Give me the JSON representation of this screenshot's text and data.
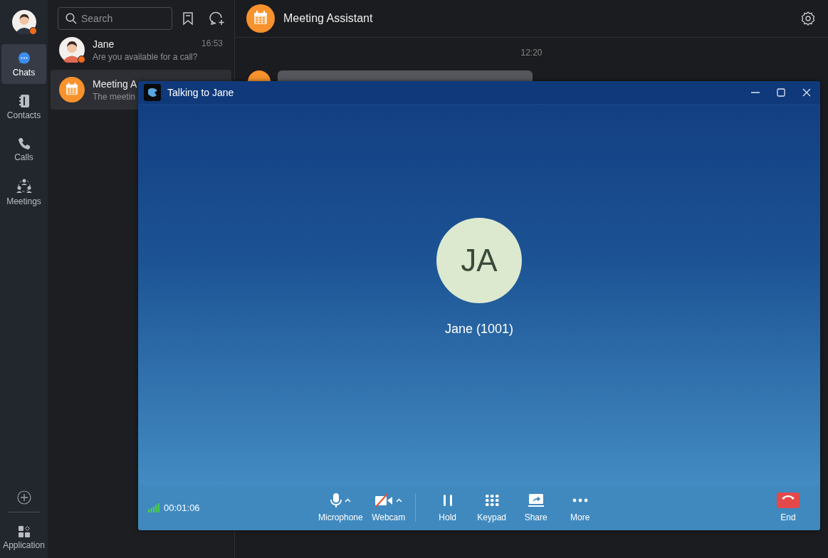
{
  "profile": {
    "status_dot": true
  },
  "nav": [
    {
      "label": "Chats",
      "kind": "chat",
      "selected": true
    },
    {
      "label": "Contacts",
      "kind": "contacts",
      "selected": false
    },
    {
      "label": "Calls",
      "kind": "phone",
      "selected": false
    },
    {
      "label": "Meetings",
      "kind": "meetings",
      "selected": false
    }
  ],
  "nav_bottom": {
    "label": "Application"
  },
  "search": {
    "placeholder": "Search"
  },
  "chats": [
    {
      "name": "Jane",
      "preview": "Are you available for a call?",
      "time": "16:53",
      "kind": "person",
      "status_dot": true,
      "selected": false
    },
    {
      "name": "Meeting A",
      "preview": "The meetin",
      "kind": "calendar",
      "status_dot": false,
      "selected": true
    }
  ],
  "conversation": {
    "title": "Meeting Assistant",
    "time": "12:20"
  },
  "call": {
    "title": "Talking to Jane",
    "initials": "JA",
    "caller": "Jane (1001)",
    "duration": "00:01:06",
    "media_controls": [
      {
        "label": "Microphone",
        "kind": "mic",
        "off": false
      },
      {
        "label": "Webcam",
        "kind": "webcam",
        "off": true
      }
    ],
    "call_controls": [
      {
        "label": "Hold",
        "kind": "hold"
      },
      {
        "label": "Keypad",
        "kind": "keypad"
      },
      {
        "label": "Share",
        "kind": "share"
      },
      {
        "label": "More",
        "kind": "more"
      }
    ],
    "end": {
      "label": "End"
    }
  }
}
